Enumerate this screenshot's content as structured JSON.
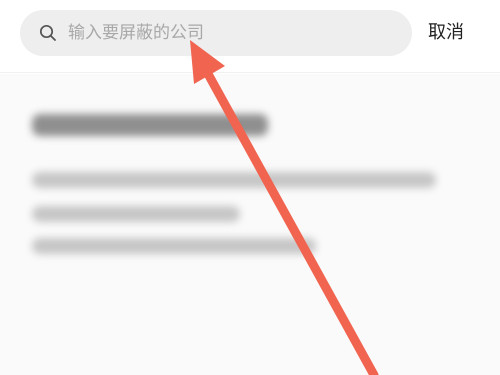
{
  "search": {
    "placeholder": "输入要屏蔽的公司",
    "value": ""
  },
  "header": {
    "cancel_label": "取消"
  },
  "icons": {
    "search": "search-icon",
    "annotation": "red-arrow-icon"
  },
  "colors": {
    "search_bg": "#eeeeee",
    "placeholder": "#a8a8a8",
    "text": "#222222",
    "arrow": "#f06450",
    "content_bg": "#fafafa"
  }
}
